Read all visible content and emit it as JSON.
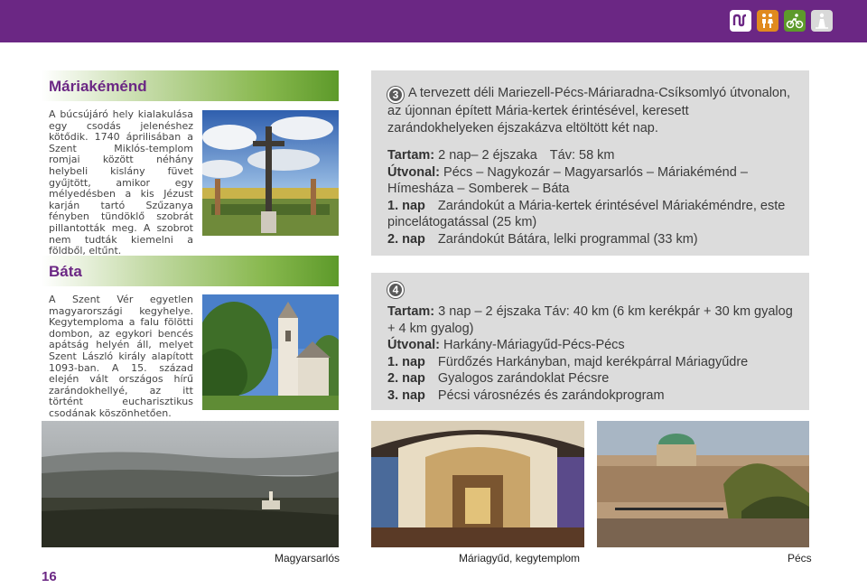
{
  "header": {
    "icons": [
      "route-icon",
      "family-icon",
      "cycling-icon",
      "pilgrim-icon"
    ],
    "bar_color": "#6b2784"
  },
  "mariakemend": {
    "title": "Máriakéménd",
    "text": "A búcsújáró hely kialakulása egy csodás jelenéshez kötődik. 1740 áprilisában a Szent Miklós-templom romjai között néhány helybeli kislány füvet gyűjtött, amikor egy mélyedésben a kis Jézust karján tartó Szűzanya fényben tündöklő szobrát pillantották meg. A szobrot nem tudták kiemelni a földből, eltűnt."
  },
  "bata": {
    "title": "Báta",
    "text": "A Szent Vér egyetlen magyarországi kegyhelye. Kegytemploma a falu fölötti dombon, az egykori bencés apátság helyén áll, melyet Szent László király alapított 1093-ban. A 15. század elején vált országos hírű zarándokhellyé, az itt történt eucharisztikus csodának köszönhetően."
  },
  "route3": {
    "number": "3",
    "intro": "A tervezett déli Mariezell-Pécs-Máriaradna-Csíksomlyó útvonalon, az újonnan épített Mária-kertek érintésével, keresett zarándokhelyeken éjszakázva eltöltött két nap.",
    "duration_label": "Tartam:",
    "duration_value": "2 nap– 2 éjszaka",
    "distance_label": "Táv:",
    "distance_value": "58 km",
    "route_label": "Útvonal:",
    "route_value": "Pécs – Nagykozár – Magyarsarlós – Máriakéménd – Hímesháza – Somberek – Báta",
    "days": [
      {
        "label": "1. nap",
        "text": "Zarándokút a Mária-kertek érintésével Máriakéméndre, este pincelátogatással (25 km)"
      },
      {
        "label": "2. nap",
        "text": "Zarándokút Bátára, lelki programmal (33 km)"
      }
    ]
  },
  "route4": {
    "number": "4",
    "duration_label": "Tartam:",
    "duration_value": "3 nap – 2 éjszaka Táv: 40 km (6 km kerékpár + 30 km gyalog + 4 km gyalog)",
    "route_label": "Útvonal:",
    "route_value": "Harkány-Máriagyűd-Pécs-Pécs",
    "days": [
      {
        "label": "1. nap",
        "text": "Fürdőzés Harkányban, majd kerékpárral Máriagyűdre"
      },
      {
        "label": "2. nap",
        "text": "Gyalogos zarándoklat Pécsre"
      },
      {
        "label": "3. nap",
        "text": "Pécsi városnézés és zarándokprogram"
      }
    ]
  },
  "captions": {
    "magyarsarlos": "Magyarsarlós",
    "mariagyud": "Máriagyűd, kegytemplom",
    "pecs": "Pécs"
  },
  "page_number": "16"
}
